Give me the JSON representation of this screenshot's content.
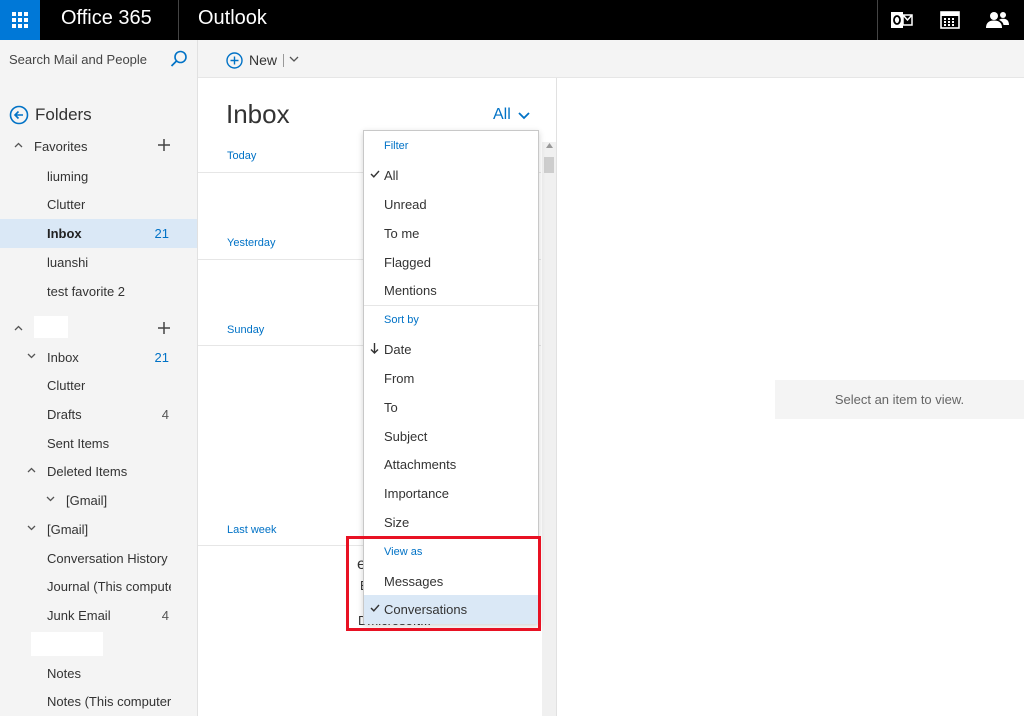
{
  "topbar": {
    "brand": "Office 365",
    "app": "Outlook"
  },
  "search": {
    "placeholder": "Search Mail and People"
  },
  "nav": {
    "folders_label": "Folders",
    "favorites_label": "Favorites",
    "favorites": [
      {
        "label": "liuming",
        "count": ""
      },
      {
        "label": "Clutter",
        "count": ""
      },
      {
        "label": "Inbox",
        "count": "21"
      },
      {
        "label": "luanshi",
        "count": ""
      },
      {
        "label": "test favorite 2",
        "count": ""
      }
    ],
    "account_items": [
      {
        "label": "Inbox",
        "count": "21"
      },
      {
        "label": "Clutter",
        "count": ""
      },
      {
        "label": "Drafts",
        "count": "4"
      },
      {
        "label": "Sent Items",
        "count": ""
      },
      {
        "label": "Deleted Items",
        "count": ""
      },
      {
        "label": "[Gmail]",
        "count": ""
      },
      {
        "label": "[Gmail]",
        "count": ""
      },
      {
        "label": "Conversation History",
        "count": ""
      },
      {
        "label": "Journal (This computer only)",
        "count": ""
      },
      {
        "label": "Junk Email",
        "count": "4"
      },
      {
        "label": "Notes",
        "count": ""
      },
      {
        "label": "Notes (This computer only)",
        "count": ""
      }
    ]
  },
  "commandbar": {
    "new_label": "New"
  },
  "list": {
    "title": "Inbox",
    "filter_value": "All",
    "groups": [
      "Today",
      "Yesterday",
      "Sunday",
      "Last week"
    ],
    "fragment_1": "e",
    "fragment_2": "E",
    "fragment_3": "Dmicrosoft..."
  },
  "reading_pane": {
    "empty_message": "Select an item to view."
  },
  "dropdown": {
    "filter_header": "Filter",
    "filter_options": [
      "All",
      "Unread",
      "To me",
      "Flagged",
      "Mentions"
    ],
    "sortby_header": "Sort by",
    "sort_options": [
      "Date",
      "From",
      "To",
      "Subject",
      "Attachments",
      "Importance",
      "Size"
    ],
    "viewas_header": "View as",
    "view_options": [
      "Messages",
      "Conversations"
    ]
  },
  "colors": {
    "accent": "#0078d7",
    "link_blue": "#0072c6",
    "selection": "#dae8f6",
    "highlight_red": "#e81123"
  }
}
